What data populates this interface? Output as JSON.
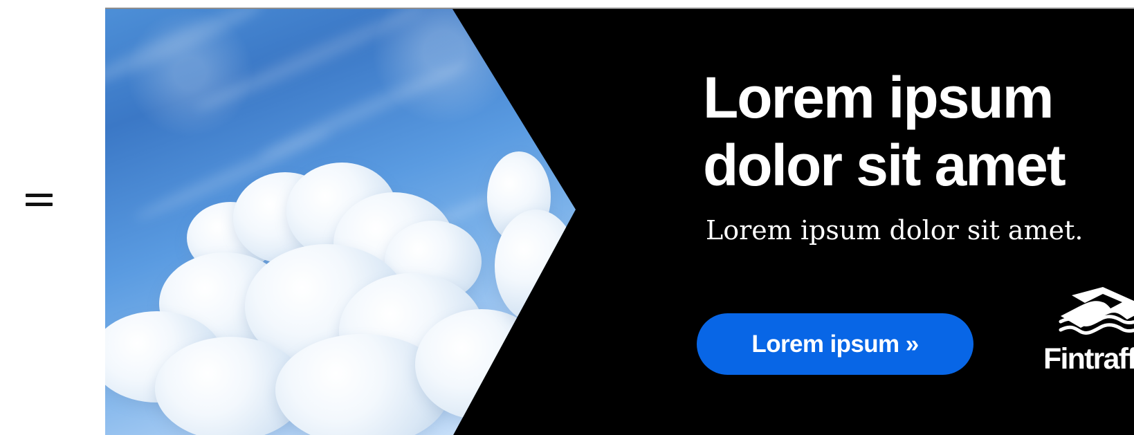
{
  "menu": {
    "icon": "hamburger-menu-icon"
  },
  "hero": {
    "image": "sky-with-clouds",
    "headline_line_1": "Lorem ipsum",
    "headline_line_2": "dolor sit amet",
    "subheadline": "Lorem ipsum dolor sit amet.",
    "cta_label": "Lorem ipsum »",
    "brand_name": "Fintraffic",
    "brand_icon": "fintraffic-logo-icon",
    "colors": {
      "banner_background": "#000000",
      "headline": "#ffffff",
      "button": "#0866e6",
      "button_text": "#ffffff",
      "sky_blue": "#4d8fd7"
    }
  }
}
